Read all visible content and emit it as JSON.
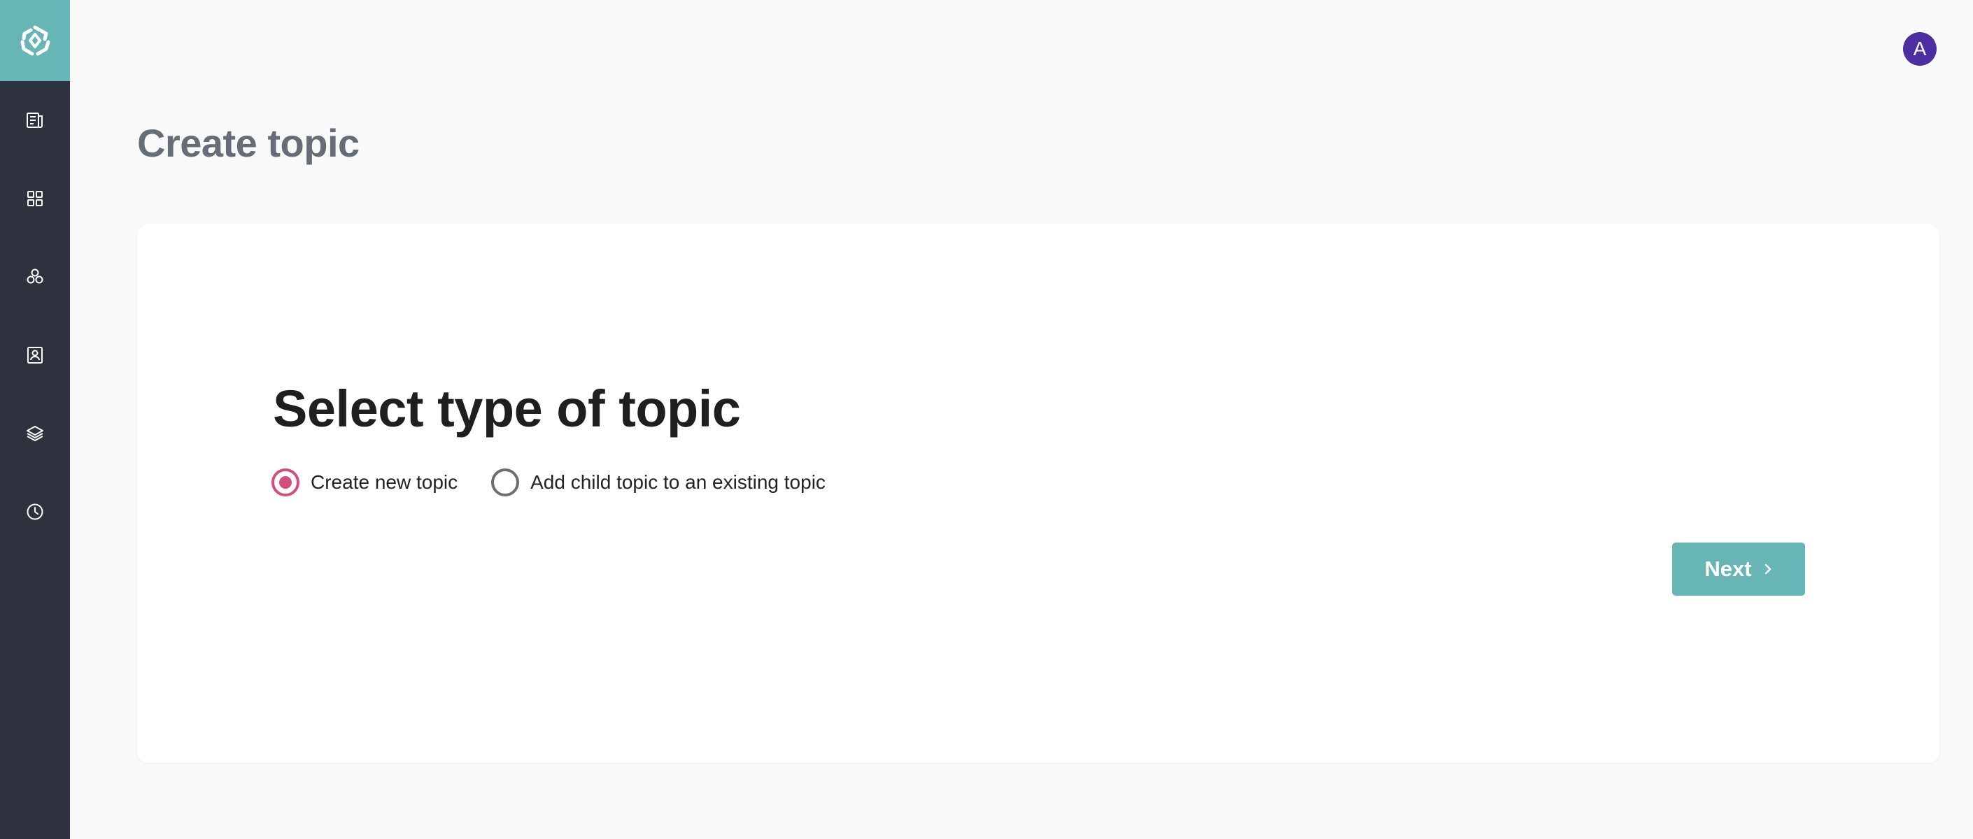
{
  "sidebar": {
    "logo_icon": "app-logo-icon",
    "items": [
      {
        "icon": "articles-icon"
      },
      {
        "icon": "grid-icon"
      },
      {
        "icon": "topics-icon"
      },
      {
        "icon": "contacts-icon"
      },
      {
        "icon": "layers-icon"
      },
      {
        "icon": "clock-icon"
      }
    ]
  },
  "header": {
    "avatar_initial": "A"
  },
  "page": {
    "title": "Create topic"
  },
  "form": {
    "heading": "Select type of topic",
    "options": [
      {
        "label": "Create new topic",
        "selected": true
      },
      {
        "label": "Add child topic to an existing topic",
        "selected": false
      }
    ],
    "next_label": "Next"
  },
  "colors": {
    "accent": "#68b5b5",
    "sidebar": "#2d323e",
    "radio_selected": "#d14f7a",
    "avatar": "#4b2fa0"
  }
}
